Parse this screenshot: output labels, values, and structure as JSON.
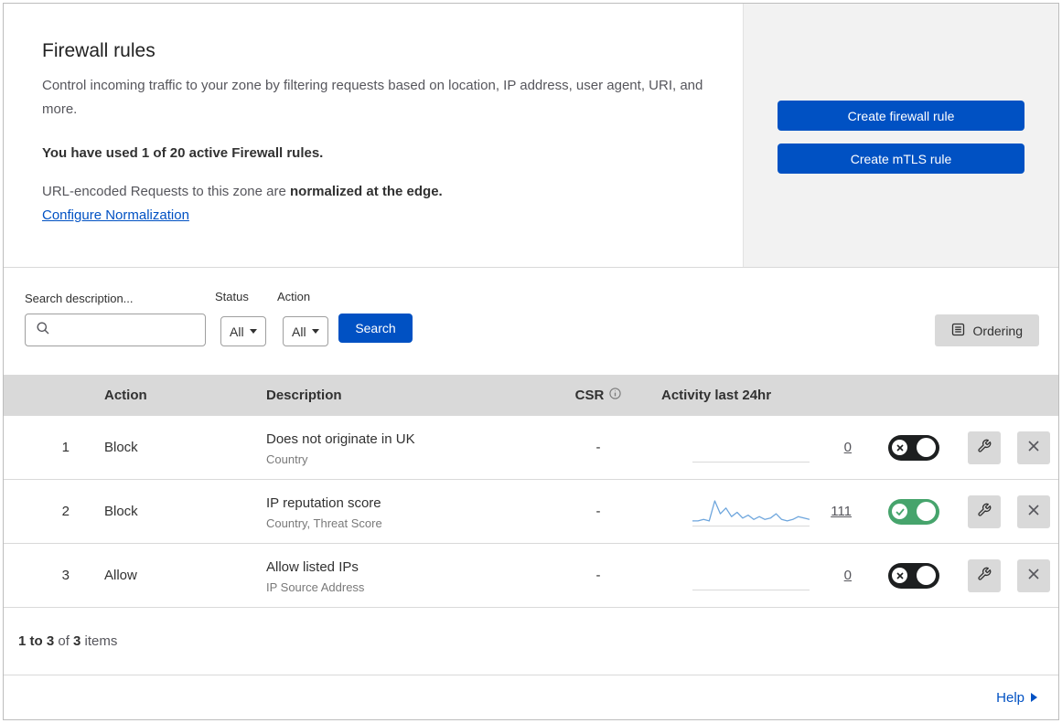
{
  "colors": {
    "primary": "#0051c3",
    "toggle_on": "#46a46c",
    "toggle_off": "#1d1f20",
    "sparkline": "#6ea6dd",
    "table_header_bg": "#d9d9d9"
  },
  "header": {
    "title": "Firewall rules",
    "description": "Control incoming traffic to your zone by filtering requests based on location, IP address, user agent, URI, and more.",
    "usage": "You have used 1 of 20 active Firewall rules.",
    "normalization_prefix": "URL-encoded Requests to this zone are ",
    "normalization_bold": "normalized at the edge.",
    "configure_link": "Configure Normalization",
    "buttons": {
      "create_firewall": "Create firewall rule",
      "create_mtls": "Create mTLS rule"
    }
  },
  "filters": {
    "search_label": "Search description...",
    "status": {
      "label": "Status",
      "value": "All"
    },
    "action": {
      "label": "Action",
      "value": "All"
    },
    "search_button": "Search",
    "ordering_button": "Ordering"
  },
  "table": {
    "headers": {
      "action": "Action",
      "description": "Description",
      "csr": "CSR",
      "activity": "Activity last 24hr"
    },
    "rows": [
      {
        "index": "1",
        "action": "Block",
        "description": "Does not originate in UK",
        "criteria": "Country",
        "csr": "-",
        "count": "0",
        "enabled": false,
        "sparkline": null
      },
      {
        "index": "2",
        "action": "Block",
        "description": "IP reputation score",
        "criteria": "Country, Threat Score",
        "csr": "-",
        "count": "111",
        "enabled": true,
        "sparkline": [
          2,
          2,
          3,
          2,
          16,
          7,
          11,
          5,
          8,
          4,
          6,
          3,
          5,
          3,
          4,
          7,
          3,
          2,
          3,
          5,
          4,
          3
        ]
      },
      {
        "index": "3",
        "action": "Allow",
        "description": "Allow listed IPs",
        "criteria": "IP Source Address",
        "csr": "-",
        "count": "0",
        "enabled": false,
        "sparkline": null
      }
    ]
  },
  "footer": {
    "range": "1 to 3",
    "of": " of ",
    "total": "3",
    "items": " items",
    "help": "Help"
  }
}
